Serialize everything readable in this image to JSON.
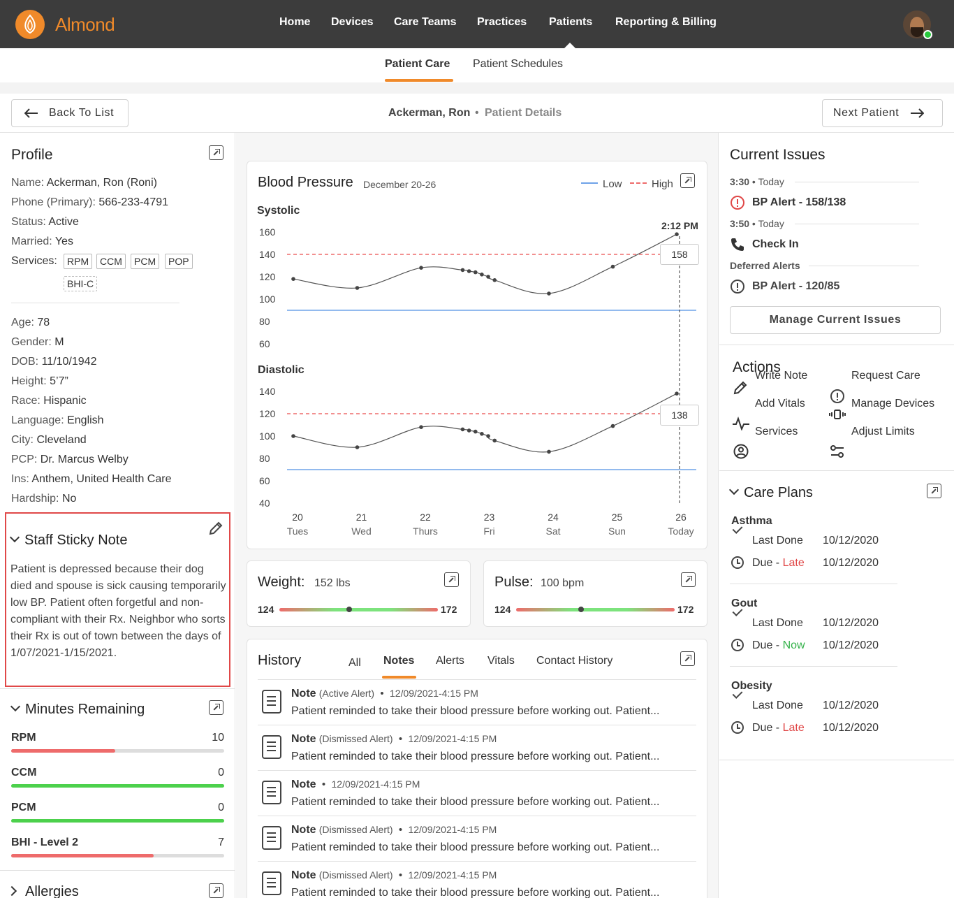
{
  "app": {
    "brand": "Almond"
  },
  "nav": {
    "items": [
      "Home",
      "Devices",
      "Care Teams",
      "Practices",
      "Patients",
      "Reporting & Billing"
    ]
  },
  "subnav": {
    "tabs": [
      "Patient Care",
      "Patient Schedules"
    ]
  },
  "header": {
    "back_label": "Back To List",
    "patient_name": "Ackerman, Ron",
    "separator": "•",
    "page": "Patient Details",
    "next_label": "Next Patient"
  },
  "profile": {
    "title": "Profile",
    "name": {
      "k": "Name:",
      "v": "Ackerman, Ron (Roni)"
    },
    "phone": {
      "k": "Phone (Primary):",
      "v": "566-233-4791"
    },
    "status": {
      "k": "Status:",
      "v": "Active"
    },
    "married": {
      "k": "Married:",
      "v": "Yes"
    },
    "services_label": "Services:",
    "services": [
      "RPM",
      "CCM",
      "PCM",
      "POP",
      "BHI-C"
    ],
    "age": {
      "k": "Age:",
      "v": "78"
    },
    "gender": {
      "k": "Gender:",
      "v": "M"
    },
    "dob": {
      "k": "DOB:",
      "v": "11/10/1942"
    },
    "height": {
      "k": "Height:",
      "v": "5’7”"
    },
    "race": {
      "k": "Race:",
      "v": "Hispanic"
    },
    "language": {
      "k": "Language:",
      "v": "English"
    },
    "city": {
      "k": "City:",
      "v": "Cleveland"
    },
    "pcp": {
      "k": "PCP:",
      "v": "Dr. Marcus Welby"
    },
    "ins": {
      "k": "Ins:",
      "v": "Anthem, United Health Care"
    },
    "hardship": {
      "k": "Hardship:",
      "v": "No"
    }
  },
  "sticky": {
    "title": "Staff Sticky Note",
    "text": "Patient is depressed because their dog died and spouse is sick causing temporarily low BP. Patient often forgetful and non-compliant with their Rx. Neighbor who sorts their Rx is out of town between the days of 1/07/2021-1/15/2021."
  },
  "minutes": {
    "title": "Minutes Remaining",
    "rows": [
      {
        "label": "RPM",
        "value": "10",
        "fill": 0.49,
        "color": "#ee6b6b"
      },
      {
        "label": "CCM",
        "value": "0",
        "fill": 1.0,
        "color": "#4cd14c"
      },
      {
        "label": "PCM",
        "value": "0",
        "fill": 1.0,
        "color": "#4cd14c"
      },
      {
        "label": "BHI - Level 2",
        "value": "7",
        "fill": 0.67,
        "color": "#ee6b6b"
      }
    ]
  },
  "allergies": {
    "title": "Allergies"
  },
  "bp": {
    "title": "Blood Pressure",
    "range": "December 20-26",
    "legend_low": "Low",
    "legend_high": "High",
    "systolic_label": "Systolic",
    "diastolic_label": "Diastolic",
    "time_label": "2:12 PM",
    "systolic_value": "158",
    "diastolic_value": "138",
    "x_days": [
      "20",
      "21",
      "22",
      "23",
      "24",
      "25",
      "26"
    ],
    "x_names": [
      "Tues",
      "Wed",
      "Thurs",
      "Fri",
      "Sat",
      "Sun",
      "Today"
    ],
    "colors": {
      "low": "#6fa3e8",
      "high": "#ee6b6b"
    }
  },
  "chart_data": [
    {
      "type": "line",
      "title": "Systolic",
      "ylim": [
        60,
        160
      ],
      "yticks": [
        160,
        140,
        120,
        100,
        80,
        60
      ],
      "high_threshold": 140,
      "low_threshold": 90,
      "x": [
        20.0,
        21.0,
        22.0,
        22.65,
        22.75,
        22.85,
        22.95,
        23.05,
        23.15,
        24.0,
        25.0,
        26.0
      ],
      "values": [
        118,
        110,
        128,
        126,
        125,
        124,
        122,
        120,
        117,
        105,
        129,
        158
      ]
    },
    {
      "type": "line",
      "title": "Diastolic",
      "ylim": [
        40,
        140
      ],
      "yticks": [
        140,
        120,
        100,
        80,
        60,
        40
      ],
      "high_threshold": 120,
      "low_threshold": 70,
      "x": [
        20.0,
        21.0,
        22.0,
        22.65,
        22.75,
        22.85,
        22.95,
        23.05,
        23.15,
        24.0,
        25.0,
        26.0
      ],
      "values": [
        100,
        90,
        108,
        106,
        105,
        104,
        102,
        100,
        96,
        86,
        109,
        138
      ]
    }
  ],
  "weight": {
    "label": "Weight:",
    "value": "152 lbs",
    "min": "124",
    "max": "172",
    "level": 0.44
  },
  "pulse": {
    "label": "Pulse:",
    "value": "100 bpm",
    "min": "124",
    "max": "172",
    "level": 0.41
  },
  "history": {
    "title": "History",
    "tabs": [
      "All",
      "Notes",
      "Alerts",
      "Vitals",
      "Contact History"
    ],
    "notes": [
      {
        "type": "Note",
        "status": "(Active Alert)",
        "date": "12/09/2021-4:15 PM",
        "text": "Patient reminded to take their blood pressure before working out. Patient..."
      },
      {
        "type": "Note",
        "status": "(Dismissed Alert)",
        "date": "12/09/2021-4:15 PM",
        "text": "Patient reminded to take their blood pressure before working out. Patient..."
      },
      {
        "type": "Note",
        "status": "",
        "date": "12/09/2021-4:15 PM",
        "text": "Patient reminded to take their blood pressure before working out. Patient..."
      },
      {
        "type": "Note",
        "status": "(Dismissed Alert)",
        "date": "12/09/2021-4:15 PM",
        "text": "Patient reminded to take their blood pressure before working out. Patient..."
      },
      {
        "type": "Note",
        "status": "(Dismissed Alert)",
        "date": "12/09/2021-4:15 PM",
        "text": "Patient reminded to take their blood pressure before working out. Patient..."
      }
    ]
  },
  "issues": {
    "title": "Current Issues",
    "time1": "3:30",
    "when1": "Today",
    "alert1": "BP Alert - 158/138",
    "time2": "3:50",
    "when2": "Today",
    "checkin": "Check In",
    "deferred": "Deferred Alerts",
    "alert2": "BP Alert - 120/85",
    "manage": "Manage Current Issues"
  },
  "actions": {
    "title": "Actions",
    "items": [
      "Write Note",
      "Request Care",
      "Add Vitals",
      "Manage Devices",
      "Services",
      "Adjust Limits"
    ]
  },
  "care_plans": {
    "title": "Care Plans",
    "last_done_label": "Last Done",
    "due_label": "Due -",
    "plans": [
      {
        "name": "Asthma",
        "last_done": "10/12/2020",
        "due_status": "Late",
        "due_date": "10/12/2020",
        "color": "#e04848"
      },
      {
        "name": "Gout",
        "last_done": "10/12/2020",
        "due_status": "Now",
        "due_date": "10/12/2020",
        "color": "#34b24a"
      },
      {
        "name": "Obesity",
        "last_done": "10/12/2020",
        "due_status": "Late",
        "due_date": "10/12/2020",
        "color": "#e04848"
      }
    ]
  }
}
